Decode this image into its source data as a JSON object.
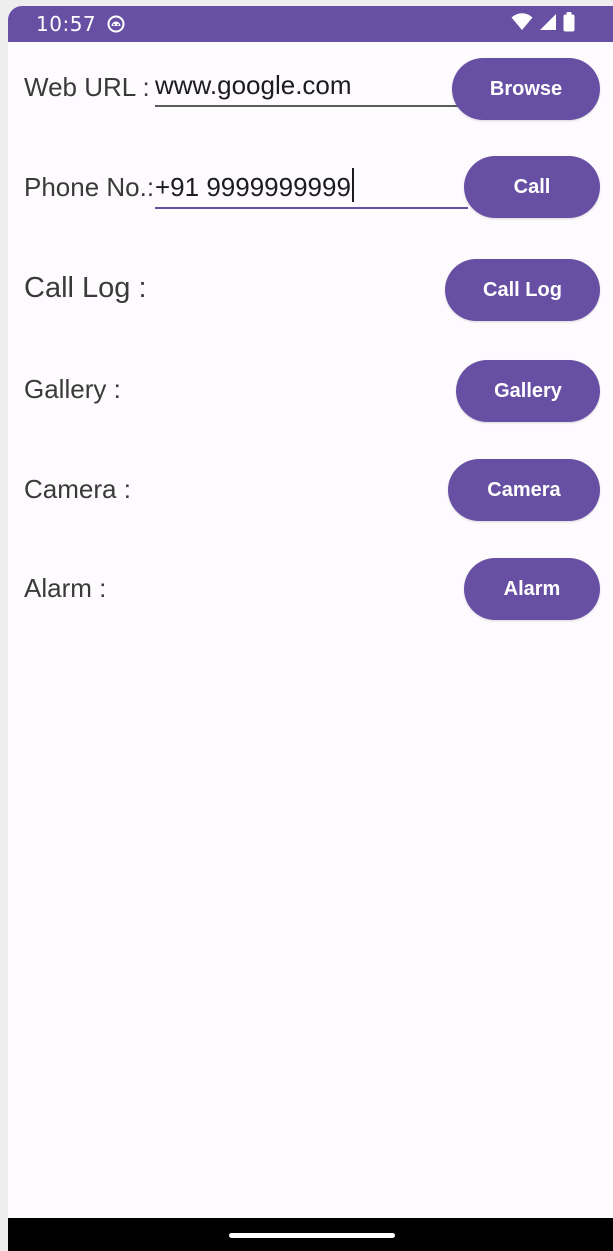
{
  "status_bar": {
    "time": "10:57",
    "app_icon": "android-robot-icon",
    "icons": [
      "wifi-icon",
      "cell-signal-icon",
      "battery-icon"
    ],
    "background_color": "#6750a4"
  },
  "rows": {
    "web_url": {
      "label": "Web URL :",
      "input_value": "www.google.com",
      "button_label": "Browse"
    },
    "phone": {
      "label": "Phone No.:",
      "input_value": "+91 9999999999",
      "button_label": "Call"
    },
    "call_log": {
      "label": "Call Log :",
      "button_label": "Call Log"
    },
    "gallery": {
      "label": "Gallery :",
      "button_label": "Gallery"
    },
    "camera": {
      "label": "Camera :",
      "button_label": "Camera"
    },
    "alarm": {
      "label": "Alarm :",
      "button_label": "Alarm"
    }
  },
  "theme": {
    "primary": "#6750a4",
    "surface": "#fefbfe",
    "on_primary": "#ffffff"
  }
}
